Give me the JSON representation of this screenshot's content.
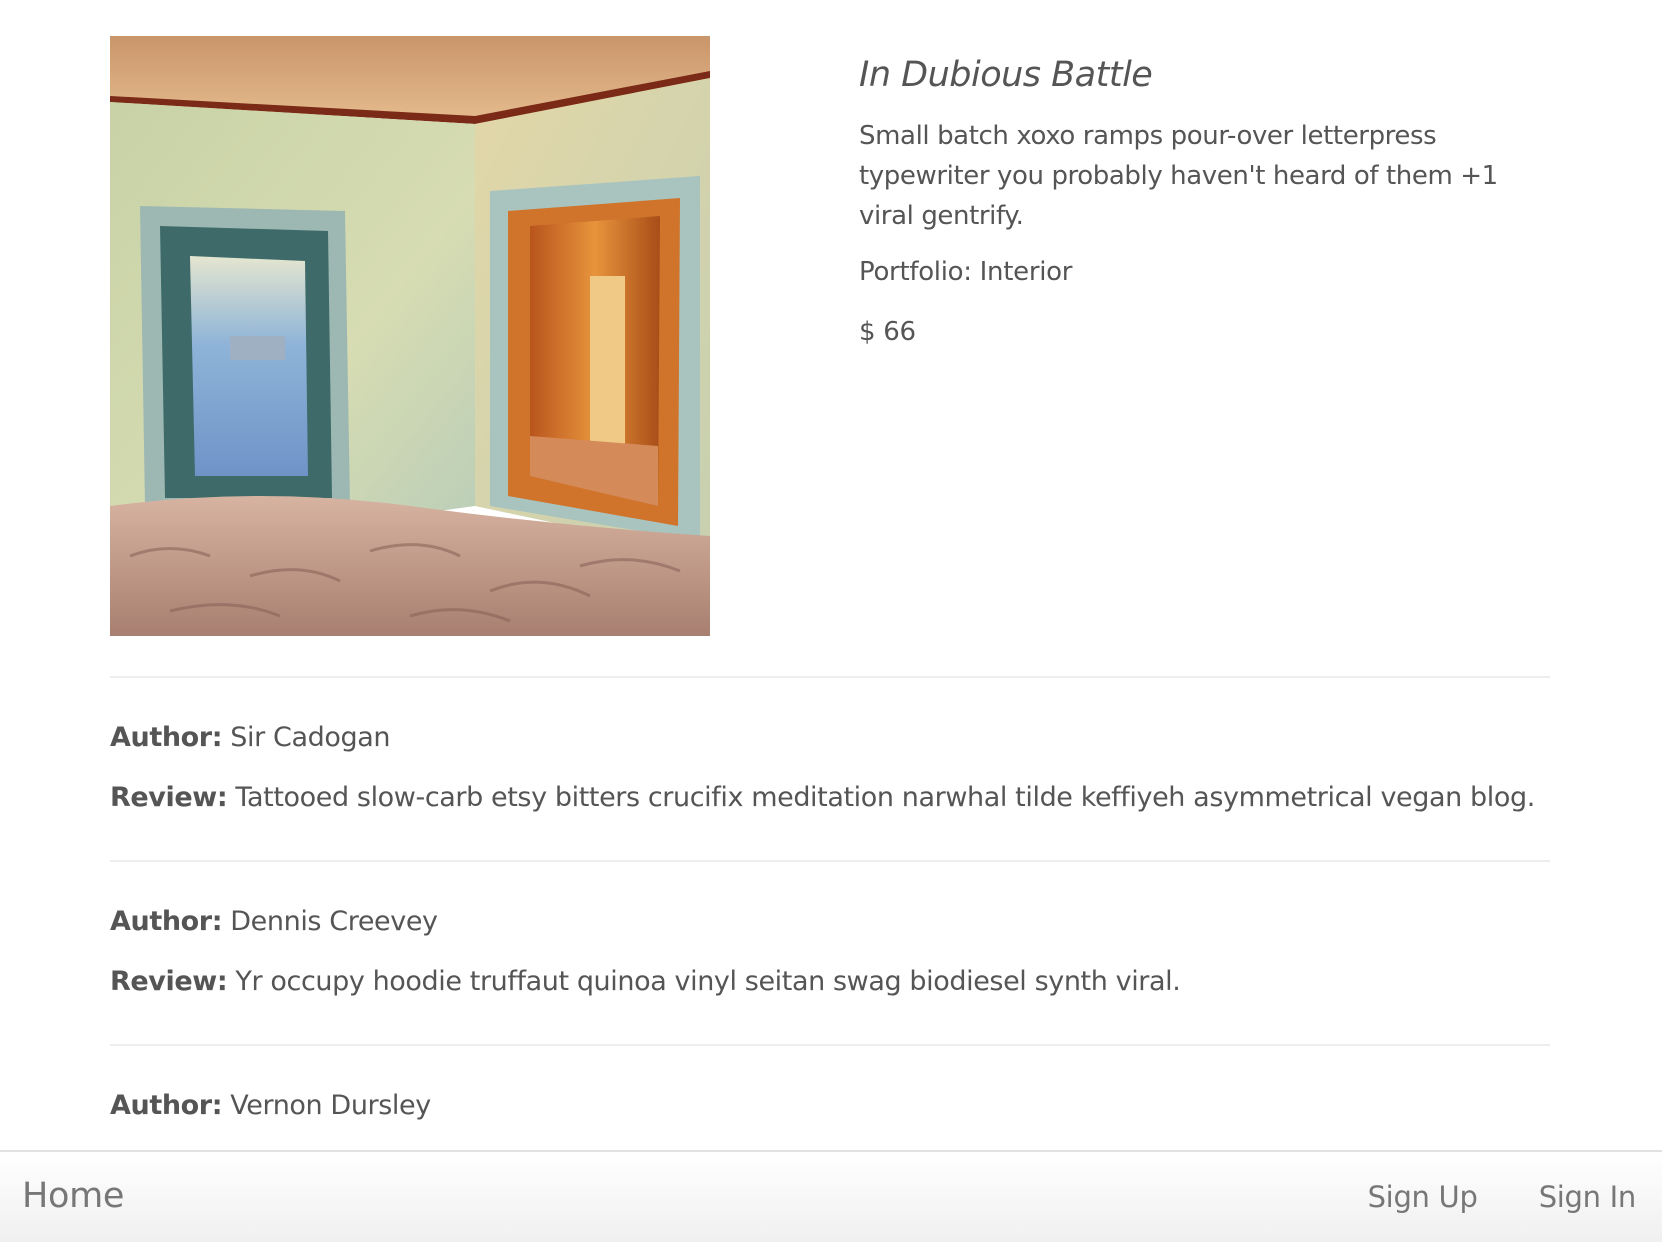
{
  "product": {
    "image_alt": "Abandoned room with sand-filled floor and two open doorways",
    "title": "In Dubious Battle",
    "description": "Small batch xoxo ramps pour-over letterpress typewriter you probably haven't heard of them +1 viral gentrify.",
    "portfolio": "Portfolio: Interior",
    "price": "$ 66"
  },
  "reviews": [
    {
      "author_label": "Author:",
      "author": " Sir Cadogan",
      "review_label": "Review:",
      "review": " Tattooed slow-carb etsy bitters crucifix meditation narwhal tilde keffiyeh asymmetrical vegan blog."
    },
    {
      "author_label": "Author:",
      "author": " Dennis Creevey",
      "review_label": "Review:",
      "review": " Yr occupy hoodie truffaut quinoa vinyl seitan swag biodiesel synth viral."
    },
    {
      "author_label": "Author:",
      "author": " Vernon Dursley"
    }
  ],
  "navbar": {
    "home": "Home",
    "sign_up": "Sign Up",
    "sign_in": "Sign In"
  }
}
